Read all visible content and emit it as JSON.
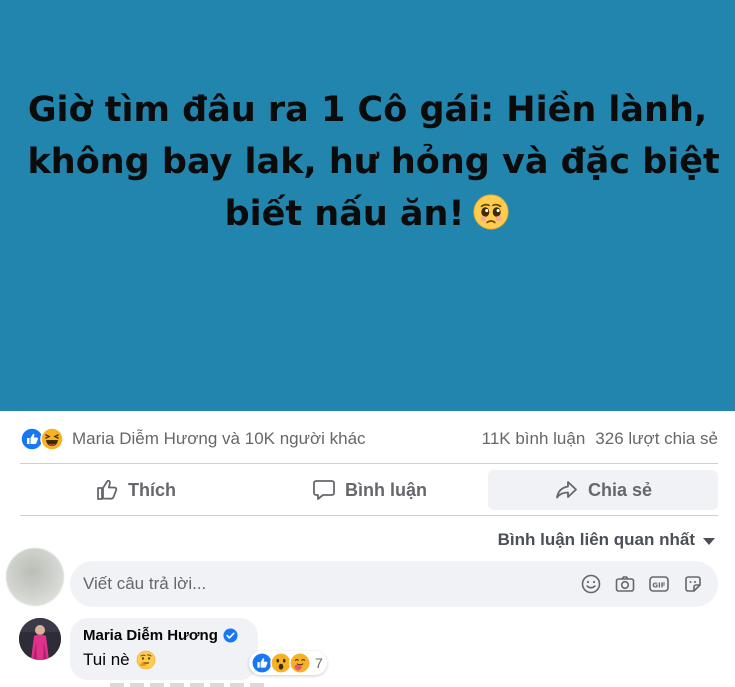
{
  "post": {
    "banner_text": [
      "Giờ tìm đâu ra 1 Cô gái: Hiền lành,",
      "không bay lak, hư hỏng và đặc biệt",
      "biết nấu ăn!"
    ],
    "banner_emoji": "pleading-face-icon",
    "banner_bg": "#2185ad"
  },
  "reactions": {
    "icons": [
      "like-icon",
      "haha-icon"
    ],
    "names": "Maria Diễm Hương và 10K người khác",
    "comments": "11K bình luận",
    "shares": "326 lượt chia sẻ"
  },
  "actions": {
    "like": "Thích",
    "comment": "Bình luận",
    "share": "Chia sẻ"
  },
  "sort": {
    "label": "Bình luận liên quan nhất"
  },
  "reply": {
    "placeholder": "Viết câu trả lời...",
    "tools": [
      "emoji-icon",
      "camera-icon",
      "gif-icon",
      "sticker-icon"
    ]
  },
  "comment": {
    "author": "Maria Diễm Hương",
    "verified": true,
    "text": "Tui nè",
    "emoji": "thinking-face-icon",
    "reaction_count": "7",
    "reaction_icons": [
      "like-icon",
      "wow-icon",
      "care-icon"
    ]
  },
  "colors": {
    "accent": "#1877f2",
    "muted_text": "#65676b",
    "bubble": "#f0f2f5"
  }
}
